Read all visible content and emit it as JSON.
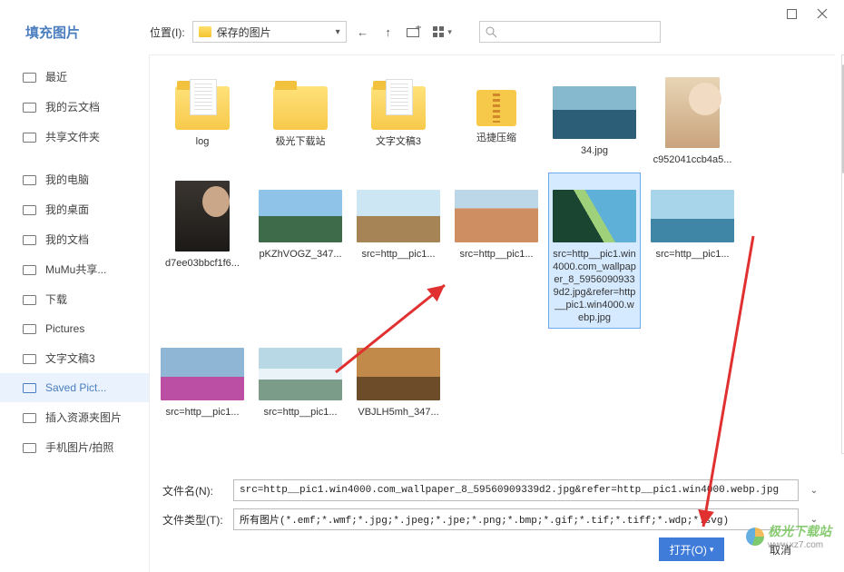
{
  "window": {
    "title": "填充图片",
    "maximize_tip": "最大化",
    "close_tip": "关闭"
  },
  "location": {
    "label": "位置(I):",
    "value": "保存的图片"
  },
  "nav": {
    "back": "后退",
    "up": "上一级",
    "new_folder": "新建文件夹",
    "view": "查看方式"
  },
  "search": {
    "placeholder": ""
  },
  "sidebar": {
    "items": [
      {
        "label": "最近",
        "icon": "clock-icon"
      },
      {
        "label": "我的云文档",
        "icon": "cloud-icon"
      },
      {
        "label": "共享文件夹",
        "icon": "share-icon"
      },
      {
        "label": "我的电脑",
        "icon": "monitor-icon"
      },
      {
        "label": "我的桌面",
        "icon": "desktop-icon"
      },
      {
        "label": "我的文档",
        "icon": "document-icon"
      },
      {
        "label": "MuMu共享...",
        "icon": "folder-icon"
      },
      {
        "label": "下载",
        "icon": "download-icon"
      },
      {
        "label": "Pictures",
        "icon": "folder-icon"
      },
      {
        "label": "文字文稿3",
        "icon": "folder-icon"
      },
      {
        "label": "Saved Pict...",
        "icon": "folder-icon",
        "active": true
      },
      {
        "label": "插入资源夹图片",
        "icon": "image-icon"
      },
      {
        "label": "手机图片/拍照",
        "icon": "phone-icon"
      }
    ]
  },
  "files": [
    {
      "name": "log",
      "kind": "folder-doc"
    },
    {
      "name": "极光下载站",
      "kind": "folder"
    },
    {
      "name": "文字文稿3",
      "kind": "folder-doc"
    },
    {
      "name": "迅捷压缩",
      "kind": "compress"
    },
    {
      "name": "34.jpg",
      "kind": "img",
      "cls": "bg-34"
    },
    {
      "name": "c952041ccb4a5...",
      "kind": "img",
      "cls": "portrait1",
      "portrait": true
    },
    {
      "name": "d7ee03bbcf1f6...",
      "kind": "img",
      "cls": "portrait2",
      "portrait": true
    },
    {
      "name": "pKZhVOGZ_347...",
      "kind": "img",
      "cls": "bg-landscape1"
    },
    {
      "name": "src=http__pic1...",
      "kind": "img",
      "cls": "bg-landscape2"
    },
    {
      "name": "src=http__pic1...",
      "kind": "img",
      "cls": "bg-landscape4"
    },
    {
      "name": "src=http__pic1.win4000.com_wallpaper_8_59560909339d2.jpg&refer=http__pic1.win4000.webp.jpg",
      "kind": "img",
      "cls": "bg-mountain",
      "selected": true
    },
    {
      "name": "src=http__pic1...",
      "kind": "img",
      "cls": "bg-lake"
    },
    {
      "name": "src=http__pic1...",
      "kind": "img",
      "cls": "bg-flower"
    },
    {
      "name": "src=http__pic1...",
      "kind": "img",
      "cls": "bg-waterfall"
    },
    {
      "name": "VBJLH5mh_347...",
      "kind": "img",
      "cls": "bg-autumn"
    }
  ],
  "fields": {
    "name_label": "文件名(N):",
    "name_value": "src=http__pic1.win4000.com_wallpaper_8_59560909339d2.jpg&refer=http__pic1.win4000.webp.jpg",
    "type_label": "文件类型(T):",
    "type_value": "所有图片(*.emf;*.wmf;*.jpg;*.jpeg;*.jpe;*.png;*.bmp;*.gif;*.tif;*.tiff;*.wdp;*.svg)"
  },
  "buttons": {
    "open": "打开(O)",
    "cancel": "取消"
  },
  "watermark": {
    "text": "极光下载站",
    "url": "www.xz7.com"
  }
}
